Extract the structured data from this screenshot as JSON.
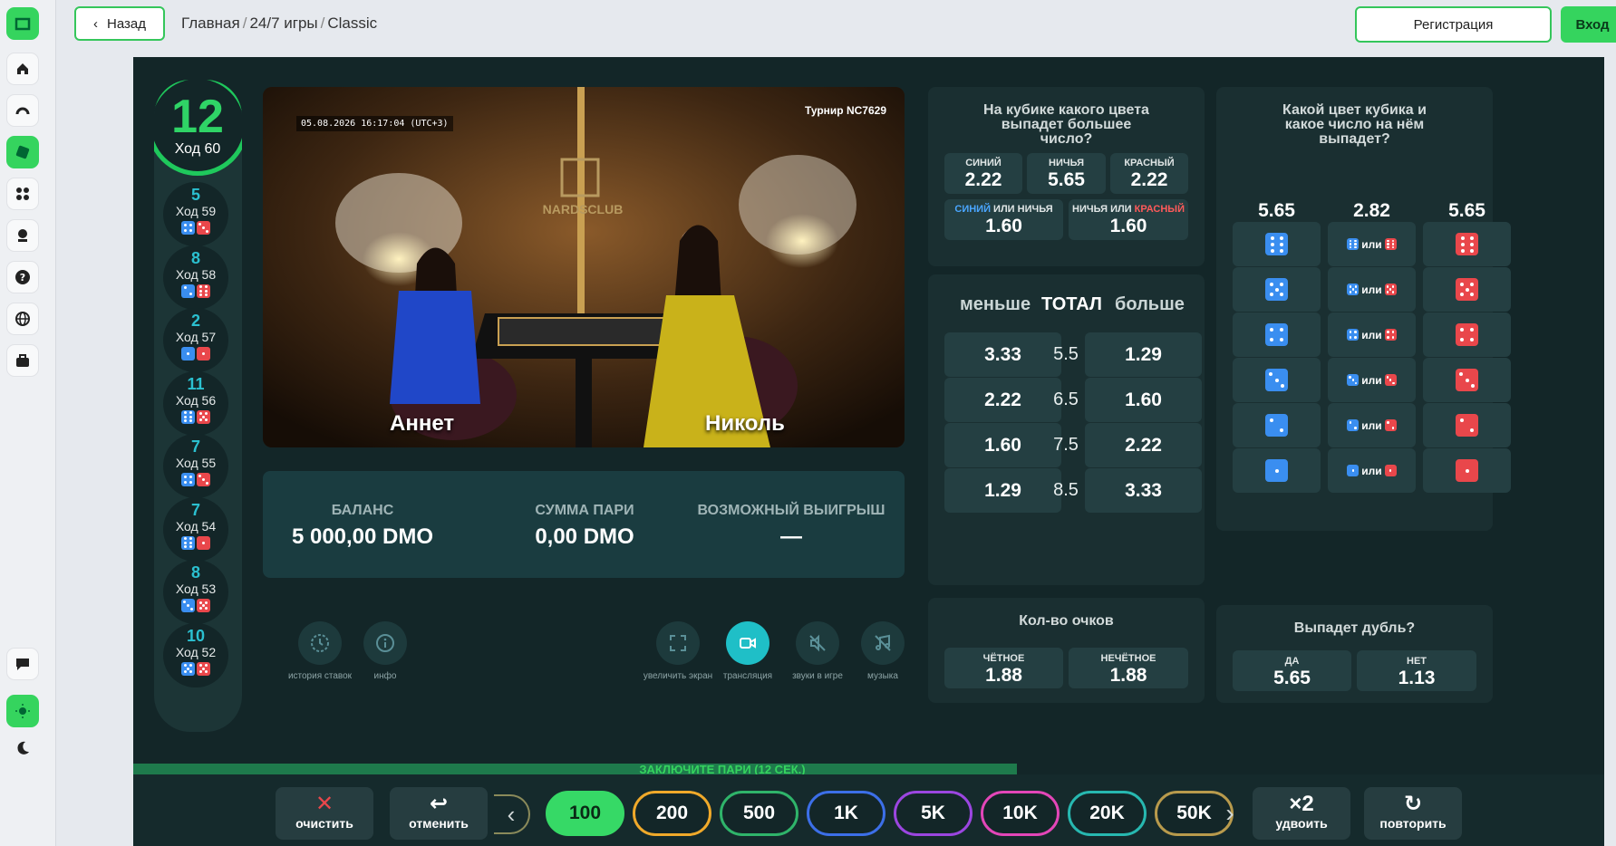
{
  "sidebar": {
    "icons": [
      "logo-icon",
      "home-icon",
      "live-icon",
      "dice-icon",
      "apps-icon",
      "support-agent-icon",
      "help-icon",
      "globe-icon",
      "briefcase-icon",
      "chat-icon",
      "sun-icon",
      "moon-icon"
    ]
  },
  "topbar": {
    "back_label": "Назад",
    "breadcrumb": [
      "Главная",
      "24/7 игры",
      "Classic"
    ],
    "register_label": "Регистрация",
    "login_label": "Вход"
  },
  "turns": {
    "current_number": "12",
    "current_label": "Ход 60",
    "history": [
      {
        "number": "5",
        "label": "Ход 59",
        "blue": 4,
        "red": 3
      },
      {
        "number": "8",
        "label": "Ход 58",
        "blue": 2,
        "red": 6
      },
      {
        "number": "2",
        "label": "Ход 57",
        "blue": 1,
        "red": 1
      },
      {
        "number": "11",
        "label": "Ход 56",
        "blue": 6,
        "red": 5
      },
      {
        "number": "7",
        "label": "Ход 55",
        "blue": 4,
        "red": 3
      },
      {
        "number": "7",
        "label": "Ход 54",
        "blue": 6,
        "red": 1
      },
      {
        "number": "8",
        "label": "Ход 53",
        "blue": 3,
        "red": 5
      },
      {
        "number": "10",
        "label": "Ход 52",
        "blue": 5,
        "red": 5
      }
    ]
  },
  "stream": {
    "timestamp": "05.08.2026 16:17:04 (UTC+3)",
    "tournament": "Турнир NC7629",
    "brand": "NARDSCLUB",
    "player_left": "Аннет",
    "player_right": "Николь"
  },
  "info": {
    "balance_label": "БАЛАНС",
    "balance_value": "5 000,00 DMO",
    "bet_label": "СУММА ПАРИ",
    "bet_value": "0,00 DMO",
    "win_label": "ВОЗМОЖНЫЙ ВЫИГРЫШ",
    "win_value": "—"
  },
  "controls": {
    "history": "история ставок",
    "info": "инфо",
    "fullscreen": "увеличить экран",
    "stream": "трансляция",
    "sounds": "звуки в игре",
    "music": "музыка"
  },
  "color_market": {
    "title": "На кубике какого цвета выпадет большее число?",
    "blue_label": "СИНИЙ",
    "blue_odds": "2.22",
    "draw_label": "НИЧЬЯ",
    "draw_odds": "5.65",
    "red_label": "КРАСНЫЙ",
    "red_odds": "2.22",
    "blue_word": "СИНИЙ",
    "or_word": "ИЛИ",
    "draw_word": "НИЧЬЯ",
    "red_word": "КРАСНЫЙ",
    "blue_or_draw_odds": "1.60",
    "draw_or_red_odds": "1.60"
  },
  "total_market": {
    "less_label": "меньше",
    "total_label": "ТОТАЛ",
    "more_label": "больше",
    "rows": [
      {
        "less": "3.33",
        "line": "5.5",
        "more": "1.29"
      },
      {
        "less": "2.22",
        "line": "6.5",
        "more": "1.60"
      },
      {
        "less": "1.60",
        "line": "7.5",
        "more": "2.22"
      },
      {
        "less": "1.29",
        "line": "8.5",
        "more": "3.33"
      }
    ]
  },
  "dice_market": {
    "title": "Какой цвет кубика и какое число на нём выпадет?",
    "col_blue": "5.65",
    "col_or": "2.82",
    "col_red": "5.65",
    "or_word": "или",
    "faces": [
      6,
      5,
      4,
      3,
      2,
      1
    ]
  },
  "points_market": {
    "title": "Кол-во очков",
    "even_label": "ЧЁТНОЕ",
    "even_odds": "1.88",
    "odd_label": "НЕЧЁТНОЕ",
    "odd_odds": "1.88"
  },
  "double_market": {
    "title": "Выпадет дубль?",
    "yes_label": "ДА",
    "yes_odds": "5.65",
    "no_label": "НЕТ",
    "no_odds": "1.13"
  },
  "betting": {
    "timer_text": "ЗАКЛЮЧИТЕ ПАРИ (12 СЕК.)",
    "clear_label": "очистить",
    "undo_label": "отменить",
    "double_label": "удвоить",
    "repeat_label": "повторить",
    "chips": [
      {
        "label": "100",
        "color": "#36d966"
      },
      {
        "label": "200",
        "color": "#f0a92a"
      },
      {
        "label": "500",
        "color": "#2fb46a"
      },
      {
        "label": "1K",
        "color": "#3c6fe8"
      },
      {
        "label": "5K",
        "color": "#9b46e0"
      },
      {
        "label": "10K",
        "color": "#e346b8"
      },
      {
        "label": "20K",
        "color": "#27b8b0"
      },
      {
        "label": "50K",
        "color": "#b89a4c"
      }
    ]
  },
  "colors": {
    "accent": "#35d45e",
    "blue_die": "#3a8ef0",
    "red_die": "#e9474b",
    "panel": "#1a2f31"
  }
}
